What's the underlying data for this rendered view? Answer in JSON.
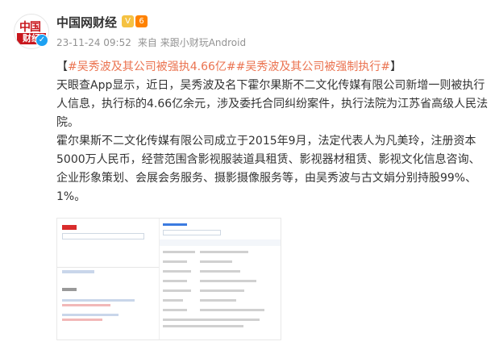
{
  "post": {
    "author": "中国网财经",
    "avatar_text_top": "中国",
    "avatar_text_bottom": "财经",
    "verified_mark": "✓",
    "badges": [
      "V",
      "6"
    ],
    "timestamp": "23-11-24 09:52",
    "source": "来自 来跟小财玩Android",
    "headline": {
      "open_bracket": "【",
      "topic1": "#吴秀波及其公司被强执4.66亿#",
      "topic2": "#吴秀波及其公司被强制执行#",
      "close_bracket": "】"
    },
    "paragraph1": "天眼查App显示，近日，吴秀波及名下霍尔果斯不二文化传媒有限公司新增一则被执行人信息，执行标的4.66亿余元，涉及委托合同纠纷案件，执行法院为江苏省高级人民法院。",
    "paragraph2": "霍尔果斯不二文化传媒有限公司成立于2015年9月，法定代表人为凡美玲，注册资本5000万人民币，经营范围含影视服装道具租赁、影视器材租赁、影视文化信息咨询、企业形象策划、会展会务服务、摄影摄像服务等，由吴秀波与古文娟分别持股99%、1%。"
  },
  "colors": {
    "topic": "#eb7350",
    "vip_gold": "#f5c242",
    "vip_orange": "#ff8200",
    "verified_blue": "#1da1f2",
    "logo_red": "#c8161d"
  }
}
